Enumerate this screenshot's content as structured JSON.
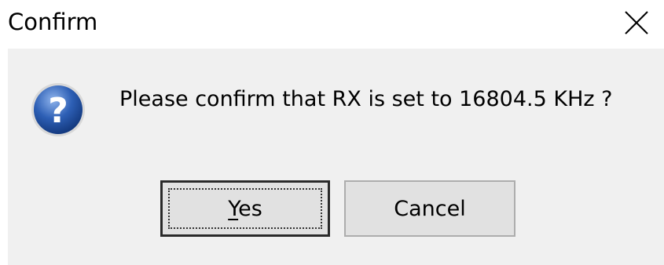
{
  "window": {
    "title": "Confirm",
    "close_icon": "close-icon"
  },
  "dialog": {
    "icon": "question-icon",
    "message": "Please confirm that RX is set to 16804.5 KHz ?"
  },
  "buttons": {
    "yes_mnemonic": "Y",
    "yes_rest": "es",
    "cancel_label": "Cancel"
  },
  "colors": {
    "body_background": "#f0f0f0",
    "title_bar_background": "#ffffff",
    "button_face": "#e1e1e1",
    "icon_blue": "#2d5fb5"
  }
}
